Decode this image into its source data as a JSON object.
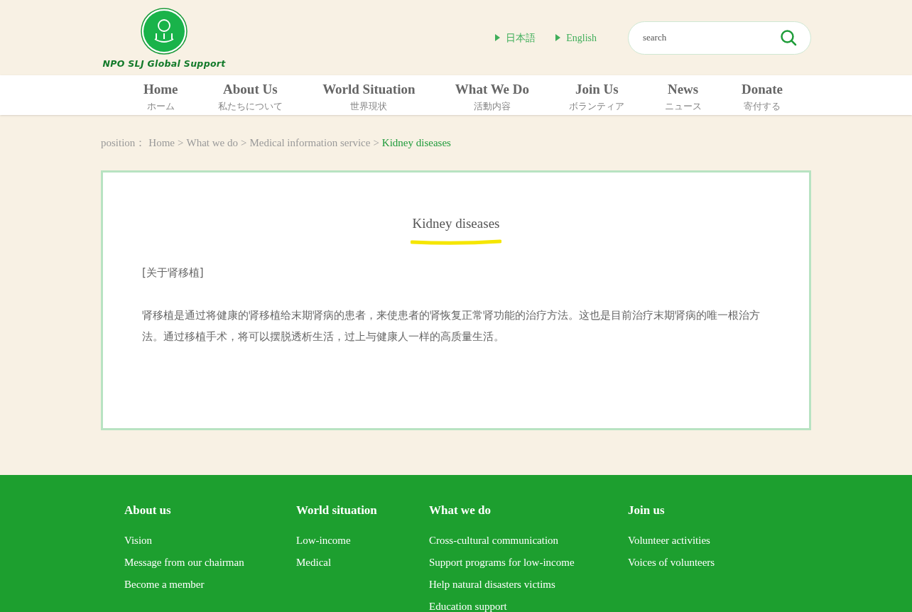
{
  "logo": {
    "text": "NPO SLJ Global Support"
  },
  "languages": [
    {
      "label": "日本語"
    },
    {
      "label": "English"
    }
  ],
  "search": {
    "placeholder": "search"
  },
  "nav": [
    {
      "label": "Home",
      "sub": "ホーム"
    },
    {
      "label": "About Us",
      "sub": "私たちについて"
    },
    {
      "label": "World Situation",
      "sub": "世界現状"
    },
    {
      "label": "What We Do",
      "sub": "活動内容"
    },
    {
      "label": "Join Us",
      "sub": "ボランティア"
    },
    {
      "label": "News",
      "sub": "ニュース"
    },
    {
      "label": "Donate",
      "sub": "寄付する"
    }
  ],
  "breadcrumb": {
    "prefix": "position：",
    "separator": ">",
    "items": [
      {
        "label": "Home",
        "current": false
      },
      {
        "label": "What we do",
        "current": false
      },
      {
        "label": "Medical information service",
        "current": false
      },
      {
        "label": "Kidney diseases",
        "current": true
      }
    ]
  },
  "article": {
    "title": "Kidney diseases",
    "paragraphs": [
      "[关于肾移植]",
      "肾移植是通过将健康的肾移植给末期肾病的患者，来使患者的肾恢复正常肾功能的治疗方法。这也是目前治疗末期肾病的唯一根治方法。通过移植手术，将可以摆脱透析生活，过上与健康人一样的高质量生活。"
    ]
  },
  "footer": {
    "columns": [
      {
        "title": "About us",
        "links": [
          "Vision",
          "Message from our chairman",
          "Become a member"
        ]
      },
      {
        "title": "World situation",
        "links": [
          "Low-income",
          "Medical"
        ]
      },
      {
        "title": "What we do",
        "links": [
          "Cross-cultural communication",
          "Support programs for low-income",
          "Help natural disasters victims",
          "Education support"
        ]
      },
      {
        "title": "Join us",
        "links": [
          "Volunteer activities",
          "Voices of volunteers"
        ]
      }
    ]
  }
}
